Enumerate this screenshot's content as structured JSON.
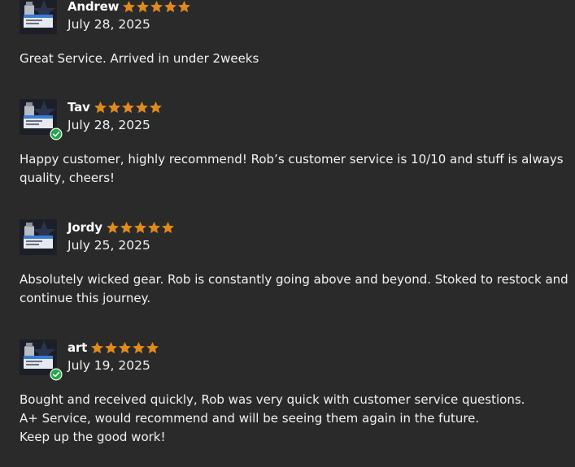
{
  "star_color": "#e08a1e",
  "verified_color": "#21a84a",
  "reviews": [
    {
      "name": "Andrew",
      "rating": 5,
      "date": "July 28, 2025",
      "verified": false,
      "body_lines": [
        "Great Service. Arrived in under 2weeks"
      ]
    },
    {
      "name": "Tav",
      "rating": 5,
      "date": "July 28, 2025",
      "verified": true,
      "body_lines": [
        "Happy customer, highly recommend! Rob’s customer service is 10/10 and stuff is always",
        "quality, cheers!"
      ]
    },
    {
      "name": "Jordy",
      "rating": 5,
      "date": "July 25, 2025",
      "verified": false,
      "body_lines": [
        "Absolutely wicked gear. Rob is constantly going above and beyond. Stoked to restock and",
        "continue this journey."
      ]
    },
    {
      "name": "art",
      "rating": 5,
      "date": "July 19, 2025",
      "verified": true,
      "body_lines": [
        "Bought and received quickly, Rob was very quick with customer service questions.",
        "A+ Service, would recommend and will be seeing them again in the future.",
        "Keep up the good work!"
      ]
    }
  ]
}
